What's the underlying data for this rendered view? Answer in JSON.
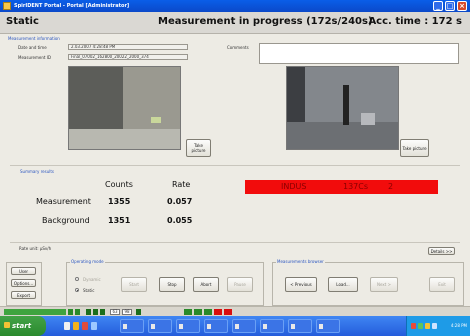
{
  "window": {
    "title": "SpirIDENT Portal - Portal [Administrator]"
  },
  "header": {
    "mode": "Static",
    "status": "Measurement in progress (172s/240s)",
    "acc_time": "Acc. time : 172 s"
  },
  "measurement_info": {
    "section_title": "Measurement information",
    "date_label": "Date and time",
    "date_value": "2.03.2007 4:28:48 PM",
    "id_label": "Measurement ID",
    "id_value": "Final_07002_162800_20022_2000_374",
    "comments_label": "Comments"
  },
  "cameras": [
    {
      "button": "Take picture"
    },
    {
      "button": "Take picture"
    }
  ],
  "summary": {
    "section_title": "Summary results",
    "col_counts": "Counts",
    "col_rate": "Rate",
    "rows": [
      {
        "label": "Measurement",
        "counts": "1355",
        "rate": "0.057"
      },
      {
        "label": "Background",
        "counts": "1351",
        "rate": "0.055"
      }
    ],
    "alarm": {
      "category": "INDUS",
      "nuclide": "137Cs",
      "count": "2",
      "color": "#f20c0c"
    }
  },
  "rate_unit": "Rate unit: µSv/h",
  "details_button": "Details >>",
  "left_buttons": [
    "User",
    "Options...",
    "Export"
  ],
  "operating_mode": {
    "title": "Operating mode",
    "dynamic": "Dynamic",
    "static": "Static",
    "buttons": [
      "Start",
      "Stop",
      "Abort",
      "Pause"
    ]
  },
  "browser": {
    "title": "Measurements browser",
    "buttons": [
      "< Previous",
      "Load...",
      "Next >",
      "Exit"
    ]
  },
  "status_strip": {
    "b1": "63",
    "b2": "98"
  },
  "taskbar": {
    "start": "start",
    "tasks": [
      "",
      "",
      "",
      "",
      "",
      "",
      "",
      ""
    ],
    "clock": "4:28 PM"
  }
}
